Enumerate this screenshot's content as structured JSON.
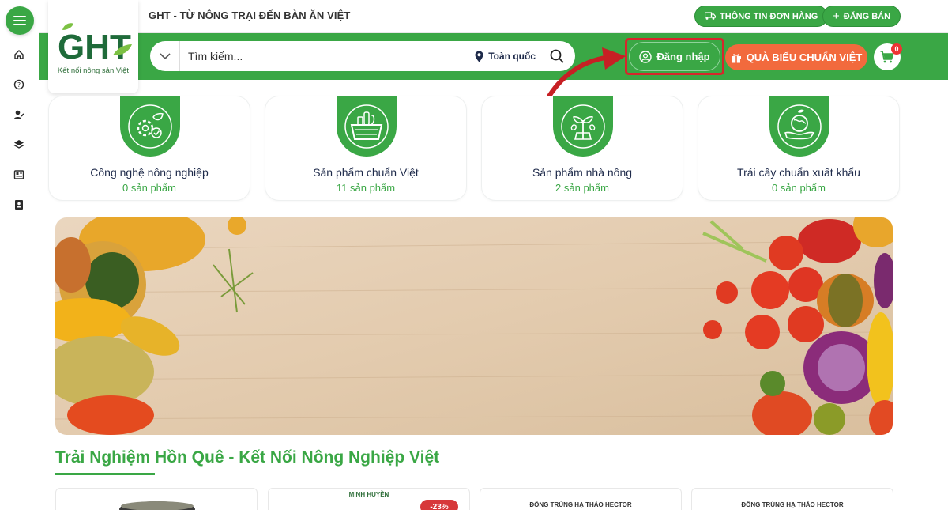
{
  "header": {
    "tagline": "GHT - TỪ NÔNG TRẠI ĐẾN BÀN ĂN VIỆT",
    "order_info_label": "THÔNG TIN ĐƠN HÀNG",
    "post_label": "ĐĂNG BÁN",
    "logo_text": "GHT",
    "logo_subtitle": "Kết nối nông sản Việt"
  },
  "search": {
    "placeholder": "Tìm kiếm...",
    "location": "Toàn quốc"
  },
  "actions": {
    "login_label": "Đăng nhập",
    "gift_label": "QUÀ BIẾU CHUẨN VIỆT",
    "cart_count": "0"
  },
  "categories": [
    {
      "name": "Công nghệ nông nghiệp",
      "count": "0 sản phẩm",
      "icon": "gear-leaf-icon"
    },
    {
      "name": "Sản phẩm chuẩn Việt",
      "count": "11 sản phẩm",
      "icon": "basket-icon"
    },
    {
      "name": "Sản phẩm nhà nông",
      "count": "2 sản phẩm",
      "icon": "plant-icon"
    },
    {
      "name": "Trái cây chuẩn xuất khẩu",
      "count": "0 sản phẩm",
      "icon": "globe-hand-icon"
    }
  ],
  "section": {
    "title": "Trải Nghiệm Hồn Quê - Kết Nối Nông Nghiệp Việt"
  },
  "products": [
    {
      "title": ""
    },
    {
      "title": "MINH HUYỀN",
      "discount": "-23%"
    },
    {
      "title": "ĐÔNG TRÙNG HẠ THẢO HECTOR"
    },
    {
      "title": "ĐÔNG TRÙNG HẠ THẢO HECTOR"
    }
  ],
  "colors": {
    "primary": "#3aa745",
    "accent": "#f26a3d",
    "highlight": "#d7262c"
  }
}
